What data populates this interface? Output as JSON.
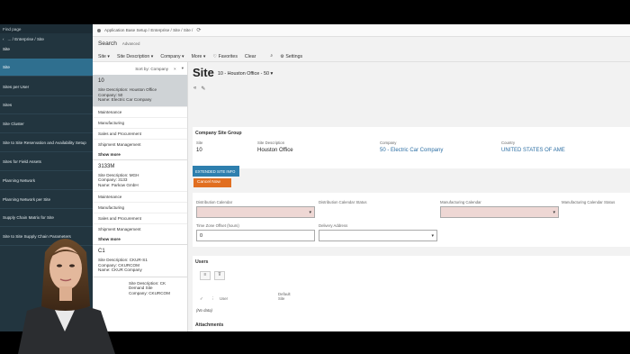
{
  "nav": {
    "find": "Find page",
    "crumb": "... / Enterprise / Site",
    "head": "Site",
    "items": [
      "Site",
      "Sites per User",
      "Sites",
      "Site Cluster",
      "Site to Site Reservation and Availability Setup",
      "Sites for Field Assets",
      "Planning Network",
      "Planning Network per Site",
      "Supply Chain Matrix for Site",
      "Site to Site Supply Chain Parameters"
    ]
  },
  "breadcrumb": "Application Base Setup / Enterprise / Site / Site /",
  "search": {
    "label": "Search",
    "advanced": "Advanced"
  },
  "menu": [
    "Site ▾",
    "Site Description ▾",
    "Company ▾",
    "More ▾",
    "♡ Favorites",
    "Clear",
    "⌕",
    "⚙ Settings"
  ],
  "list": {
    "sort": "Sort by: Company",
    "cards": [
      {
        "id": "10",
        "desc": "Site Description:  Houston Office",
        "company": "Company:  50",
        "name": "Name:  Electric Car Company",
        "links": [
          "Maintenance",
          "Manufacturing",
          "Sales and Procurement",
          "Shipment Management"
        ],
        "more": "Show more"
      },
      {
        "id": "3133M",
        "desc": "Site Description:  MGH",
        "company": "Company:  3133",
        "name": "Name:  Parkow GmbH",
        "links": [
          "Maintenance",
          "Manufacturing",
          "Sales and Procurement",
          "Shipment Management"
        ],
        "more": "Show more"
      },
      {
        "id": "C1",
        "desc": "Site Description:  CKUR-S1",
        "company": "Company:  CKURCOM",
        "name": "Name:  CKUR Company"
      },
      {
        "id": "",
        "desc": "Site Description:  CK Demand Site",
        "company": "Company:  CKURCOM",
        "name": ""
      }
    ]
  },
  "detail": {
    "title": "Site",
    "subtitle": "10 - Houston Office - 50  ▾",
    "group1": {
      "title": "Company Site Group",
      "site_label": "Site",
      "site": "10",
      "desc_label": "Site Description",
      "desc": "Houston Office",
      "company_label": "Company",
      "company": "50 - Electric Car Company",
      "country_label": "Country",
      "country": "UNITED STATES OF AME"
    },
    "tab": "EXTENDED SITE INFO",
    "cancel": "Cancel Now",
    "group2": {
      "dist_cal": "Distribution Calendar",
      "dist_cal_status": "Distribution Calendar Status",
      "man_cal": "Manufacturing Calendar",
      "man_cal_status": "Manufacturing Calendar Status",
      "tz_label": "Time Zone Offset (hours)",
      "tz": "0",
      "delivery": "Delivery Address"
    },
    "users": {
      "title": "Users",
      "col_user": "User",
      "col_default": "Default Site",
      "nodata": "(No data)"
    },
    "attachments": "Attachments"
  }
}
